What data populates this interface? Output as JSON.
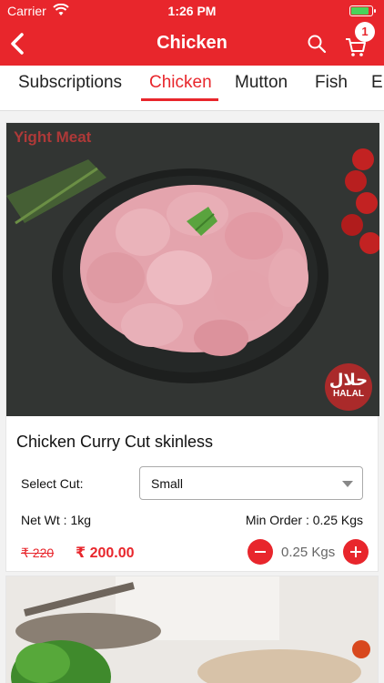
{
  "status": {
    "carrier": "Carrier",
    "time": "1:26 PM"
  },
  "nav": {
    "title": "Chicken",
    "cart_count": "1"
  },
  "tabs": [
    {
      "label": "Subscriptions"
    },
    {
      "label": "Chicken"
    },
    {
      "label": "Mutton"
    },
    {
      "label": "Fish"
    },
    {
      "label": "E"
    }
  ],
  "active_tab": "Chicken",
  "product": {
    "brand": "Yight Meat",
    "halal_seal_ar": "حلال",
    "halal_seal_en": "HALAL",
    "title": "Chicken Curry Cut skinless",
    "cut_label": "Select Cut:",
    "cut_value": "Small",
    "net_weight": "Net Wt : 1kg",
    "min_order": "Min Order : 0.25 Kgs",
    "old_price": "₹ 220",
    "price": "₹ 200.00",
    "quantity": "0.25 Kgs"
  },
  "colors": {
    "accent": "#e8262c",
    "background": "#f2f2f2"
  },
  "icons": [
    "back-icon",
    "search-icon",
    "cart-icon",
    "wifi-icon",
    "battery-icon",
    "chevron-down-icon",
    "minus-icon",
    "plus-icon"
  ]
}
